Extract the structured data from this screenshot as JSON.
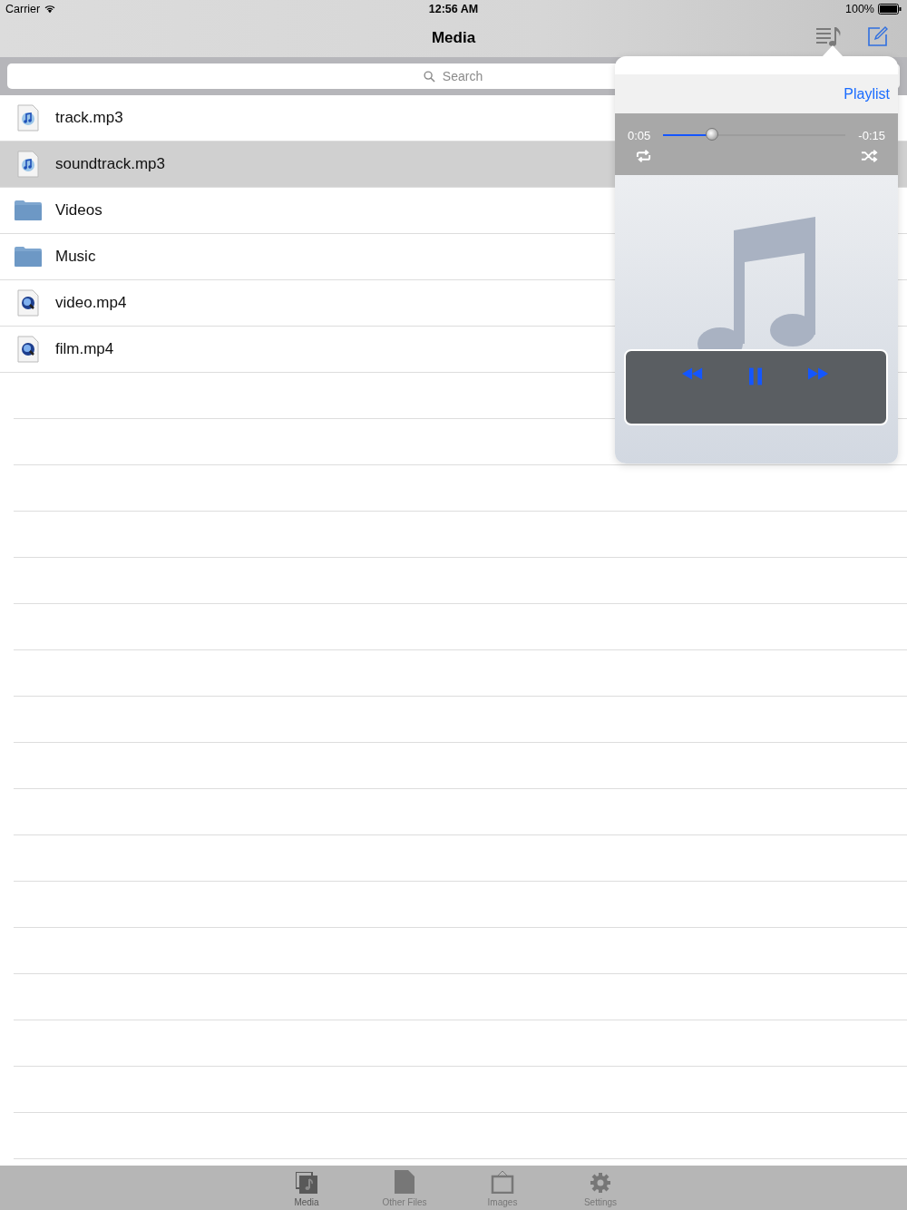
{
  "status_bar": {
    "carrier": "Carrier",
    "time": "12:56 AM",
    "battery": "100%"
  },
  "nav_bar": {
    "title": "Media"
  },
  "search": {
    "placeholder": "Search"
  },
  "files": [
    {
      "name": "track.mp3",
      "kind": "audio",
      "selected": false
    },
    {
      "name": "soundtrack.mp3",
      "kind": "audio",
      "selected": true
    },
    {
      "name": "Videos",
      "kind": "folder",
      "selected": false
    },
    {
      "name": "Music",
      "kind": "folder",
      "selected": false
    },
    {
      "name": "video.mp4",
      "kind": "video",
      "selected": false
    },
    {
      "name": "film.mp4",
      "kind": "video",
      "selected": false
    }
  ],
  "player": {
    "playlist_button": "Playlist",
    "elapsed": "0:05",
    "remaining": "-0:15",
    "level": 0.27
  },
  "tab_bar": [
    {
      "label": "Media",
      "kind": "media",
      "selected": true
    },
    {
      "label": "Other Files",
      "kind": "files",
      "selected": false
    },
    {
      "label": "Images",
      "kind": "images",
      "selected": false
    },
    {
      "label": "Settings",
      "kind": "settings",
      "selected": false
    }
  ]
}
